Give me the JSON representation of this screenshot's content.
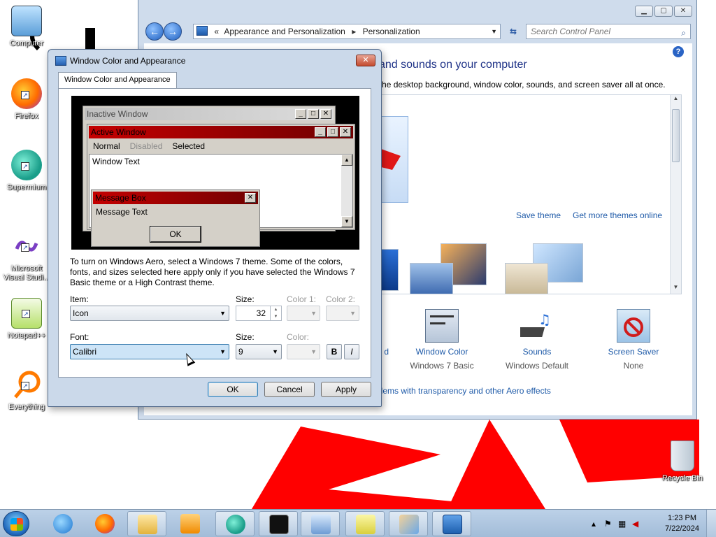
{
  "desktop": {
    "icons": [
      {
        "label": "Computer",
        "name": "computer"
      },
      {
        "label": "Firefox",
        "name": "firefox"
      },
      {
        "label": "Supermium",
        "name": "supermium"
      },
      {
        "label": "Microsoft Visual Studi...",
        "name": "visual-studio"
      },
      {
        "label": "Notepad++",
        "name": "notepad-plus-plus"
      },
      {
        "label": "Everything",
        "name": "everything"
      },
      {
        "label": "Recycle Bin",
        "name": "recycle-bin"
      }
    ]
  },
  "control_panel": {
    "breadcrumb": {
      "root": "Appearance and Personalization",
      "current": "Personalization",
      "prefix": "«"
    },
    "search_placeholder": "Search Control Panel",
    "heading": "ls and sounds on your computer",
    "subheading": "ge the desktop background, window color, sounds, and screen saver all at once.",
    "theme_links": {
      "save": "Save theme",
      "more": "Get more themes online"
    },
    "bottom_items": [
      {
        "title": "d",
        "value": ""
      },
      {
        "title": "Window Color",
        "value": "Windows 7 Basic"
      },
      {
        "title": "Sounds",
        "value": "Windows Default"
      },
      {
        "title": "Screen Saver",
        "value": "None"
      }
    ],
    "aero_link": "blems with transparency and other Aero effects"
  },
  "dialog": {
    "title": "Window Color and Appearance",
    "tab": "Window Color and Appearance",
    "close_glyph": "✕",
    "preview": {
      "inactive_title": "Inactive Window",
      "active_title": "Active Window",
      "menu": {
        "normal": "Normal",
        "disabled": "Disabled",
        "selected": "Selected"
      },
      "window_text": "Window Text",
      "message_box_title": "Message Box",
      "message_text": "Message Text",
      "ok": "OK"
    },
    "info": "To turn on Windows Aero, select a Windows 7 theme.  Some of the colors, fonts, and sizes selected here apply only if you have selected the Windows 7 Basic theme or a High Contrast theme.",
    "item": {
      "label": "Item:",
      "value": "Icon"
    },
    "item_size": {
      "label": "Size:",
      "value": "32"
    },
    "color1": {
      "label": "Color 1:"
    },
    "color2": {
      "label": "Color 2:"
    },
    "font": {
      "label": "Font:",
      "value": "Calibri"
    },
    "font_size": {
      "label": "Size:",
      "value": "9"
    },
    "font_color": {
      "label": "Color:"
    },
    "bold": "B",
    "italic": "I",
    "buttons": {
      "ok": "OK",
      "cancel": "Cancel",
      "apply": "Apply"
    }
  },
  "taskbar": {
    "clock_time": "1:23 PM",
    "clock_date": "7/22/2024"
  },
  "colors": {
    "active_title": "#c40000",
    "link": "#1e5aa8",
    "wallpaper_shape": "#ff0000"
  }
}
